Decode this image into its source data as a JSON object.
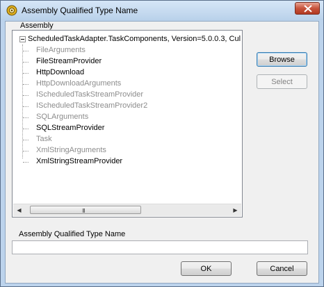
{
  "window": {
    "title": "Assembly Qualified Type Name"
  },
  "assembly": {
    "group_label": "Assembly",
    "root": "ScheduledTaskAdapter.TaskComponents, Version=5.0.0.3, Cul",
    "items": [
      {
        "label": "FileArguments",
        "enabled": false
      },
      {
        "label": "FileStreamProvider",
        "enabled": true
      },
      {
        "label": "HttpDownload",
        "enabled": true
      },
      {
        "label": "HttpDownloadArguments",
        "enabled": false
      },
      {
        "label": "IScheduledTaskStreamProvider",
        "enabled": false
      },
      {
        "label": "IScheduledTaskStreamProvider2",
        "enabled": false
      },
      {
        "label": "SQLArguments",
        "enabled": false
      },
      {
        "label": "SQLStreamProvider",
        "enabled": true
      },
      {
        "label": "Task",
        "enabled": false
      },
      {
        "label": "XmlStringArguments",
        "enabled": false
      },
      {
        "label": "XmlStringStreamProvider",
        "enabled": true
      }
    ],
    "scroll_grip": "III"
  },
  "buttons": {
    "browse": "Browse",
    "select": "Select",
    "ok": "OK",
    "cancel": "Cancel"
  },
  "type_name": {
    "label": "Assembly Qualified Type Name",
    "value": ""
  }
}
